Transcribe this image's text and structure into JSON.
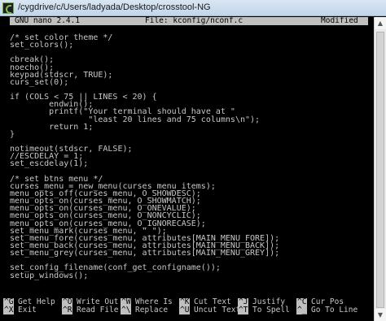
{
  "window": {
    "title": "/cygdrive/c/Users/ladyada/Desktop/crosstool-NG"
  },
  "nano": {
    "version": "GNU nano 2.4.1",
    "file": "File: kconfig/nconf.c",
    "status": "Modified"
  },
  "code_lines": [
    "/* set color theme */",
    "set_colors();",
    "",
    "cbreak();",
    "noecho();",
    "keypad(stdscr, TRUE);",
    "curs_set(0);",
    "",
    "if (COLS < 75 || LINES < 20) {",
    "        endwin();",
    "        printf(\"Your terminal should have at \"",
    "                \"least 20 lines and 75 columns\\n\");",
    "        return 1;",
    "}",
    "",
    "notimeout(stdscr, FALSE);",
    "//ESCDELAY = 1;",
    "set_escdelay(1);",
    "",
    "/* set btns menu */",
    "curses_menu = new_menu(curses_menu_items);",
    "menu_opts_off(curses_menu, O_SHOWDESC);",
    "menu_opts_on(curses_menu, O_SHOWMATCH);",
    "menu_opts_on(curses_menu, O_ONEVALUE);",
    "menu_opts_on(curses_menu, O_NONCYCLIC);",
    "menu_opts_on(curses_menu, O_IGNORECASE);",
    "set_menu_mark(curses_menu, \" \");",
    "set_menu_fore(curses_menu, attributes[MAIN_MENU_FORE]);",
    "set_menu_back(curses_menu, attributes[MAIN_MENU_BACK]);",
    "set_menu_grey(curses_menu, attributes[MAIN_MENU_GREY]);",
    "",
    "set_config_filename(conf_get_configname());",
    "setup_windows();"
  ],
  "shortcuts_row1": [
    {
      "key": "^G",
      "label": "Get Help"
    },
    {
      "key": "^O",
      "label": "Write Out"
    },
    {
      "key": "^W",
      "label": "Where Is"
    },
    {
      "key": "^K",
      "label": "Cut Text"
    },
    {
      "key": "^J",
      "label": "Justify"
    },
    {
      "key": "^C",
      "label": "Cur Pos"
    }
  ],
  "shortcuts_row2": [
    {
      "key": "^X",
      "label": "Exit"
    },
    {
      "key": "^R",
      "label": "Read File"
    },
    {
      "key": "^\\",
      "label": "Replace"
    },
    {
      "key": "^U",
      "label": "Uncut Text"
    },
    {
      "key": "^T",
      "label": "To Spell"
    },
    {
      "key": "^_",
      "label": "Go To Line"
    }
  ],
  "scrollbar": {
    "up_icon": "▲",
    "down_icon": "▼"
  }
}
